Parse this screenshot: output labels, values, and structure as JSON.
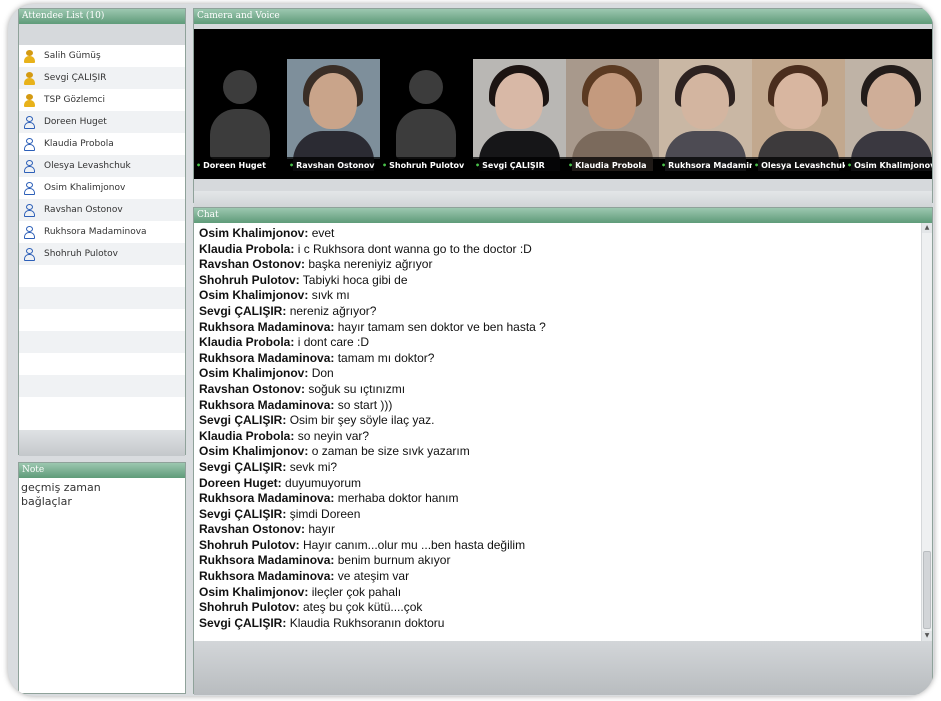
{
  "attendee_panel": {
    "title": "Attendee List (10)",
    "attendees": [
      {
        "name": "Salih Gümüş",
        "role": "host"
      },
      {
        "name": "Sevgi ÇALIŞIR",
        "role": "host"
      },
      {
        "name": "TSP Gözlemci",
        "role": "host"
      },
      {
        "name": "Doreen Huget",
        "role": "guest"
      },
      {
        "name": "Klaudia Probola",
        "role": "guest"
      },
      {
        "name": "Olesya Levashchuk",
        "role": "guest"
      },
      {
        "name": "Osim Khalimjonov",
        "role": "guest"
      },
      {
        "name": "Ravshan Ostonov",
        "role": "guest"
      },
      {
        "name": "Rukhsora Madaminova",
        "role": "guest"
      },
      {
        "name": "Shohruh Pulotov",
        "role": "guest"
      }
    ]
  },
  "note_panel": {
    "title": "Note",
    "lines": [
      "geçmiş zaman",
      "bağlaçlar"
    ]
  },
  "camera_panel": {
    "title": "Camera and Voice",
    "tiles": [
      {
        "name": "Doreen Huget",
        "video": false
      },
      {
        "name": "Ravshan Ostonov",
        "video": true,
        "skin": "#c9a48a",
        "hair": "#3a2e26",
        "torso": "#2b2b33",
        "bg": "#7e8f9b"
      },
      {
        "name": "Shohruh Pulotov",
        "video": false
      },
      {
        "name": "Sevgi ÇALIŞIR",
        "video": true,
        "skin": "#d8b8a6",
        "hair": "#1c1412",
        "torso": "#161618",
        "bg": "#b9b7b4"
      },
      {
        "name": "Klaudia Probola",
        "video": true,
        "skin": "#c49a7e",
        "hair": "#5b3a22",
        "torso": "#7b6a5c",
        "bg": "#a8998c"
      },
      {
        "name": "Rukhsora Madaminova",
        "video": true,
        "skin": "#d3b5a0",
        "hair": "#2d2220",
        "torso": "#4d4b53",
        "bg": "#c9b7a4"
      },
      {
        "name": "Olesya Levashchuk",
        "video": true,
        "skin": "#d8b6a0",
        "hair": "#4a2d1d",
        "torso": "#3d3a3c",
        "bg": "#c2a88e"
      },
      {
        "name": "Osim Khalimjonov",
        "video": true,
        "skin": "#cfae98",
        "hair": "#221c1a",
        "torso": "#3a3840",
        "bg": "#bfb3a6"
      }
    ]
  },
  "chat_panel": {
    "title": "Chat",
    "messages": [
      {
        "who": "Osim Khalimjonov:",
        "text": "evet"
      },
      {
        "who": "Klaudia Probola:",
        "text": "i c Rukhsora dont wanna go to the doctor :D"
      },
      {
        "who": "Ravshan Ostonov:",
        "text": "başka nereniyiz ağrıyor"
      },
      {
        "who": "Shohruh Pulotov:",
        "text": "Tabiyki hoca gibi de"
      },
      {
        "who": "Osim Khalimjonov:",
        "text": "sıvk mı"
      },
      {
        "who": "Sevgi ÇALIŞIR:",
        "text": "nereniz ağrıyor?"
      },
      {
        "who": "Rukhsora Madaminova:",
        "text": "hayır tamam sen doktor ve ben hasta ?"
      },
      {
        "who": "Klaudia Probola:",
        "text": "i dont care :D"
      },
      {
        "who": "Rukhsora Madaminova:",
        "text": "tamam mı doktor?"
      },
      {
        "who": "Osim Khalimjonov:",
        "text": "Don"
      },
      {
        "who": "Ravshan Ostonov:",
        "text": "soğuk su ıçtınızmı"
      },
      {
        "who": "Rukhsora Madaminova:",
        "text": "so start )))"
      },
      {
        "who": "Sevgi ÇALIŞIR:",
        "text": "Osim bir şey söyle ilaç yaz."
      },
      {
        "who": "Klaudia Probola:",
        "text": "so neyin var?"
      },
      {
        "who": "Osim Khalimjonov:",
        "text": "o zaman be size sıvk yazarım"
      },
      {
        "who": "Sevgi ÇALIŞIR:",
        "text": "sevk mi?"
      },
      {
        "who": "Doreen Huget:",
        "text": "duyumuyorum"
      },
      {
        "who": "Rukhsora Madaminova:",
        "text": "merhaba doktor hanım"
      },
      {
        "who": "Sevgi ÇALIŞIR:",
        "text": "şimdi Doreen"
      },
      {
        "who": "Ravshan Ostonov:",
        "text": "hayır"
      },
      {
        "who": "Shohruh Pulotov:",
        "text": "Hayır canım...olur mu ...ben hasta değilim"
      },
      {
        "who": "Rukhsora Madaminova:",
        "text": "benim burnum akıyor"
      },
      {
        "who": "Rukhsora Madaminova:",
        "text": "ve ateşim var"
      },
      {
        "who": "Osim Khalimjonov:",
        "text": "ileçler çok pahalı"
      },
      {
        "who": "Shohruh Pulotov:",
        "text": "ateş bu çok kütü....çok"
      },
      {
        "who": "Sevgi ÇALIŞIR:",
        "text": "Klaudia Rukhsoranın doktoru"
      }
    ]
  }
}
